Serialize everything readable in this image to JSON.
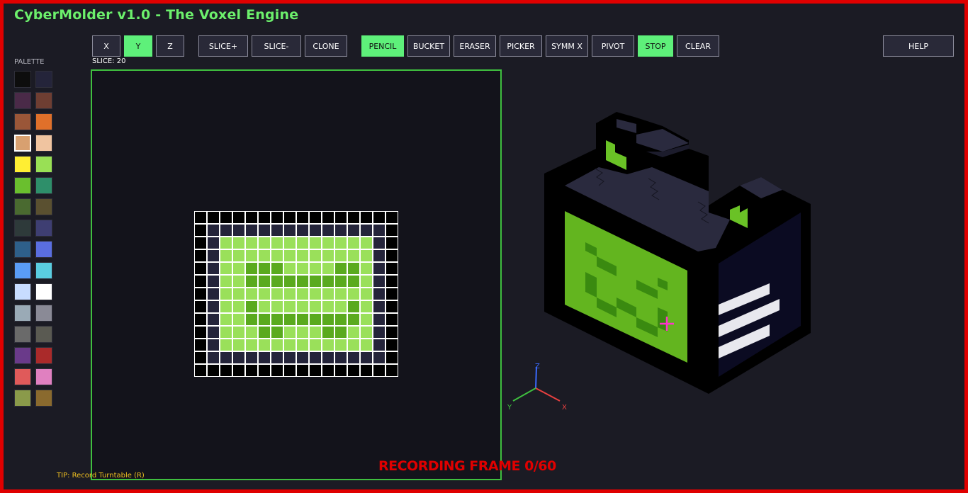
{
  "app": {
    "title": "CyberMolder v1.0 - The Voxel Engine"
  },
  "toolbar": {
    "axis_x": "X",
    "axis_y": "Y",
    "axis_z": "Z",
    "slice_plus": "SLICE+",
    "slice_minus": "SLICE-",
    "clone": "CLONE",
    "pencil": "PENCIL",
    "bucket": "BUCKET",
    "eraser": "ERASER",
    "picker": "PICKER",
    "symm_x": "SYMM X",
    "pivot": "PIVOT",
    "stop": "STOP",
    "clear": "CLEAR",
    "help": "HELP",
    "active_axis": "Y",
    "active_tool": "PENCIL",
    "stop_active": true
  },
  "slice": {
    "label": "SLICE: 20",
    "value": 20
  },
  "palette": {
    "label": "PALETTE",
    "selected_index": 6,
    "colors": [
      "#0d0d0d",
      "#24243a",
      "#4a2a48",
      "#6e3e32",
      "#9a5638",
      "#e0702a",
      "#d8a070",
      "#f0c4a0",
      "#ffee33",
      "#99e055",
      "#6abf2e",
      "#2e8f6a",
      "#4a6a30",
      "#5a5030",
      "#2e3a3a",
      "#3e3e72",
      "#2e5f8a",
      "#5a6ee0",
      "#5a9cf6",
      "#5acde0",
      "#c8dcff",
      "#ffffff",
      "#9aaab6",
      "#8a8a96",
      "#6a6a6a",
      "#5a5a52",
      "#6a3a8a",
      "#aa2a2a",
      "#e05a5a",
      "#e080c0",
      "#8a9a4a",
      "#8a6a2e"
    ]
  },
  "slice_grid": {
    "cols": 16,
    "rows": 13,
    "colors": {
      "empty": "#000000",
      "frame": "#24243a",
      "light": "#9ae05a",
      "dark": "#5aaa1e"
    },
    "cells": [
      "0000000000000000",
      "0111111111111110",
      "0122222222222210",
      "0122222222222210",
      "0122333222233210",
      "0122333333333210",
      "0122222222222210",
      "0122322222223210",
      "0122333333333210",
      "0122233222332210",
      "0122222222222210",
      "0111111111111110",
      "0000000000000000"
    ]
  },
  "tip": "TIP: Record Turntable (R)",
  "recording": "RECORDING FRAME 0/60",
  "axis_labels": {
    "x": "X",
    "y": "Y",
    "z": "Z"
  },
  "colors": {
    "accent": "#5ef07a",
    "border_red": "#e00000",
    "panel_border": "#3fbf3f",
    "tip": "#f0c020",
    "crosshair": "#ff33cc"
  }
}
